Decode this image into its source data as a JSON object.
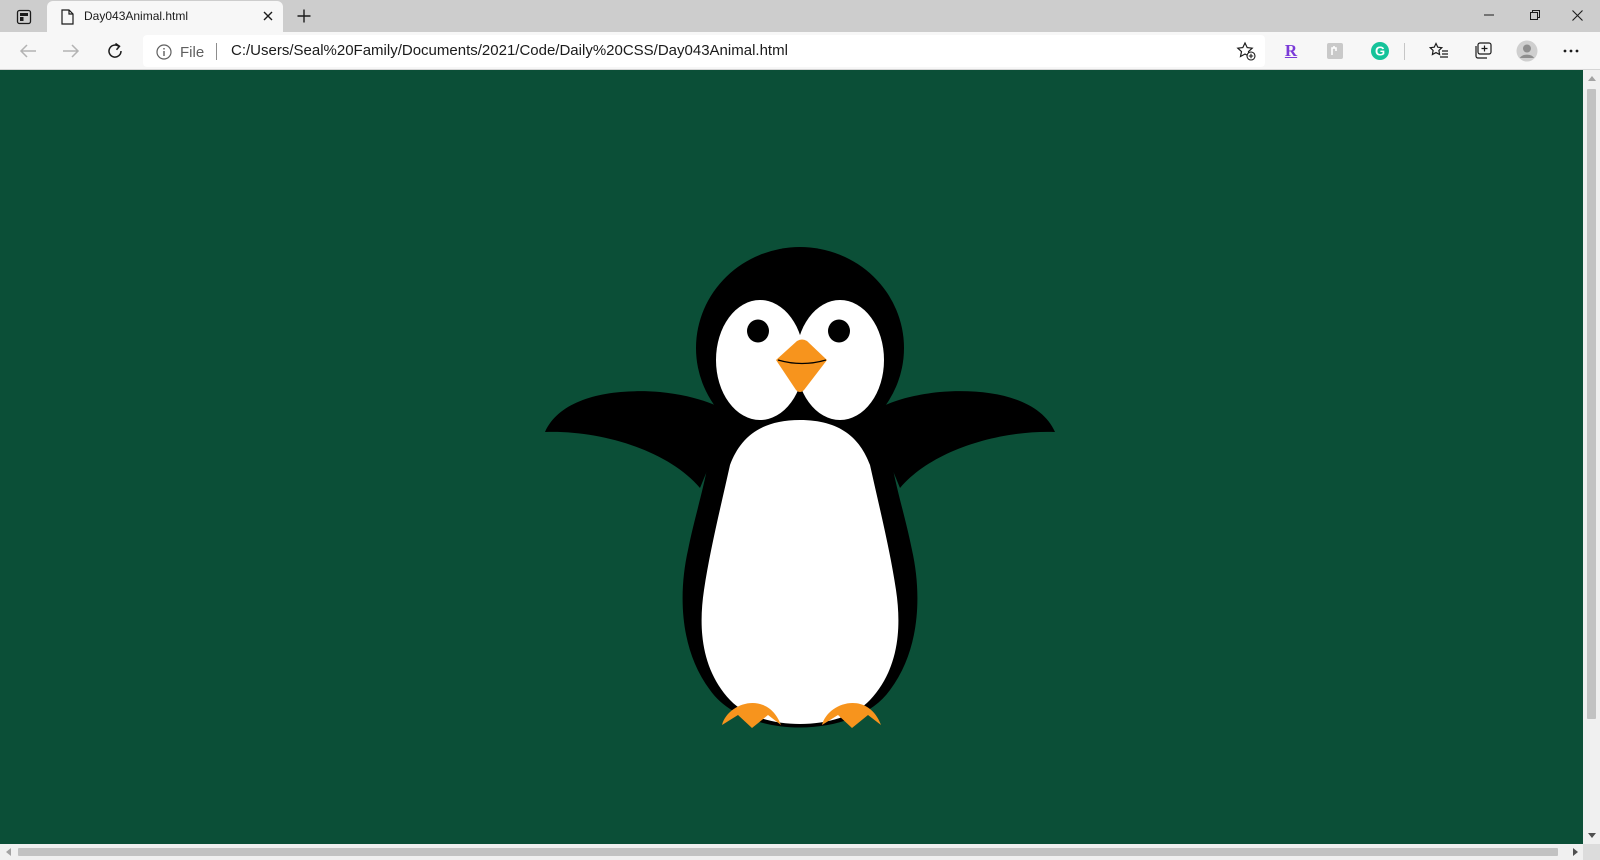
{
  "browser": {
    "tab": {
      "title": "Day043Animal.html"
    },
    "address": {
      "site_info_label": "File",
      "url": "C:/Users/Seal%20Family/Documents/2021/Code/Daily%20CSS/Day043Animal.html"
    },
    "extensions": {
      "r_label": "R",
      "g_label": "G"
    }
  },
  "colors": {
    "page_background": "#0b4f37",
    "penguin_body": "#000000",
    "penguin_belly": "#ffffff",
    "beak_and_feet": "#f7941d",
    "r_extension": "#7a3ad8",
    "g_extension": "#15c39a"
  },
  "icons": [
    "tab-actions-icon",
    "file-icon",
    "close-icon",
    "plus-icon",
    "minimize-icon",
    "restore-icon",
    "back-arrow-icon",
    "forward-arrow-icon",
    "refresh-icon",
    "info-icon",
    "add-favorite-icon",
    "favorites-icon",
    "collections-icon",
    "profile-icon",
    "more-icon"
  ]
}
